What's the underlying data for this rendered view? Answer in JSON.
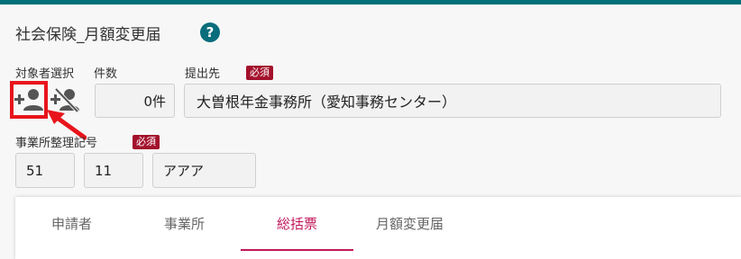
{
  "header": {
    "title": "社会保険_月額変更届",
    "help_glyph": "?"
  },
  "labels": {
    "target_select": "対象者選択",
    "count": "件数",
    "destination": "提出先",
    "office_code": "事業所整理記号"
  },
  "required_badge": "必須",
  "fields": {
    "count_value": "0件",
    "destination_value": "大曽根年金事務所（愛知事務センター）",
    "office_code_1": "51",
    "office_code_2": "11",
    "office_code_3": "アアア"
  },
  "icons": {
    "add_person": "person-add-icon",
    "remove_person": "person-remove-icon",
    "help": "help-icon"
  },
  "colors": {
    "accent": "#00707a",
    "required": "#a3112c",
    "tab_active": "#c2185b",
    "highlight": "#e8141c"
  },
  "tabs": [
    {
      "label": "申請者",
      "active": false
    },
    {
      "label": "事業所",
      "active": false
    },
    {
      "label": "総括票",
      "active": true
    },
    {
      "label": "月額変更届",
      "active": false
    }
  ]
}
